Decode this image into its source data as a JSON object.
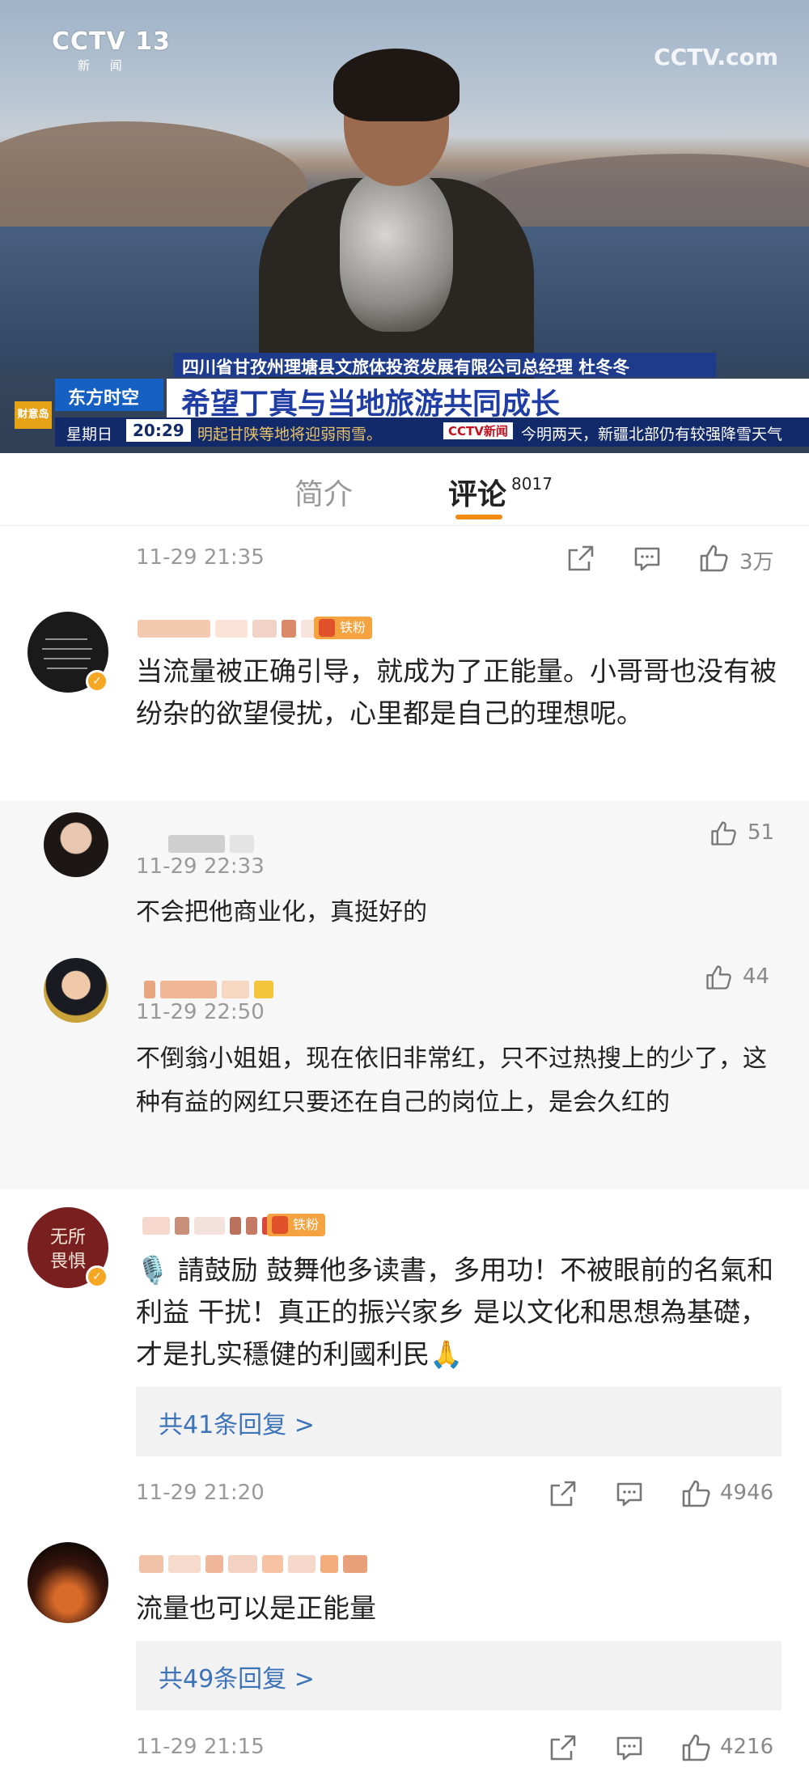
{
  "video": {
    "channel_logo": "CCTV 13",
    "channel_sub": "新 闻",
    "watermark": "CCTV.com",
    "name_strip": "四川省甘孜州理塘县文旅体投资发展有限公司总经理 杜冬冬",
    "program": "东方时空",
    "headline": "希望丁真与当地旅游共同成长",
    "mini_logo": "财意岛",
    "ticker_day": "星期日",
    "ticker_time": "20:29",
    "ticker_text": "明起甘陕等地将迎弱雨雪。",
    "ticker_logo": "CCTV新闻",
    "ticker_text2": "今明两天，新疆北部仍有较强降雪天气"
  },
  "tabs": {
    "intro_label": "简介",
    "comments_label": "评论",
    "comments_count": "8017"
  },
  "top_meta": {
    "time": "11-29 21:35",
    "likes": "3万"
  },
  "comments": [
    {
      "badge": "铁粉",
      "text": "当流量被正确引导，就成为了正能量。小哥哥也没有被纷杂的欲望侵扰，心里都是自己的理想呢。"
    },
    {
      "time": "11-29 22:33",
      "likes": "51",
      "text": "不会把他商业化，真挺好的"
    },
    {
      "time": "11-29 22:50",
      "likes": "44",
      "text": "不倒翁小姐姐，现在依旧非常红，只不过热搜上的少了，这种有益的网红只要还在自己的岗位上，是会久红的"
    },
    {
      "badge": "铁粉",
      "text": "🎙️ 請鼓励 鼓舞他多读書，多用功！不被眼前的名氣和利益 干扰！真正的振兴家乡 是以文化和思想為基礎，才是扎实穩健的利國利民🙏",
      "reply_label": "共41条回复 >",
      "time": "11-29 21:20",
      "likes": "4946"
    },
    {
      "text": "流量也可以是正能量",
      "reply_label": "共49条回复 >",
      "time": "11-29 21:15",
      "likes": "4216"
    }
  ],
  "icons": [
    "share-icon",
    "comment-icon",
    "thumbs-up-icon",
    "verified-icon"
  ],
  "colors": {
    "accent": "#f08a12",
    "link": "#3d73b9",
    "badge": "#f4a340",
    "verified": "#f5a623"
  }
}
